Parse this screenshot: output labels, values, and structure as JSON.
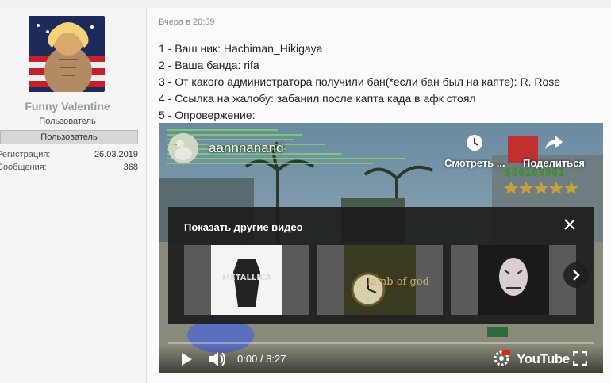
{
  "user": {
    "name": "Funny Valentine",
    "title": "Пользователь",
    "banner": "Пользователь",
    "stats": [
      {
        "label": "Регистрация:",
        "value": "26.03.2019"
      },
      {
        "label": "Сообщения:",
        "value": "368"
      }
    ]
  },
  "post": {
    "date": "Вчера в 20:59",
    "lines": [
      "1 - Ваш ник: Hachiman_Hikigaya",
      "2 - Ваша банда: rifa",
      "3 - От какого администратора получили бан(*если бан был на капте): R. Rose",
      "4 - Ссылка на жалобу: забанил после капта када в афк стоял",
      "5 - Опровержение:"
    ]
  },
  "video": {
    "channel_name": "aannnanand",
    "watch_label": "Смотреть ...",
    "share_label": "Поделиться",
    "overlay_title": "Показать другие видео",
    "time": "0:00 / 8:27",
    "logo": "YouTube",
    "hud_money": "$00169981",
    "progress": 0,
    "thumbnails": [
      {
        "name": "metallica-thumbnail",
        "text": "METALLICA"
      },
      {
        "name": "lamb-of-god-thumbnail",
        "text": "lamb of god"
      },
      {
        "name": "slipknot-thumbnail",
        "text": ""
      }
    ],
    "icons": [
      "clock-icon",
      "share-icon",
      "close-icon",
      "chevron-right-icon",
      "play-icon",
      "volume-icon",
      "hd-settings-icon",
      "fullscreen-icon"
    ]
  }
}
